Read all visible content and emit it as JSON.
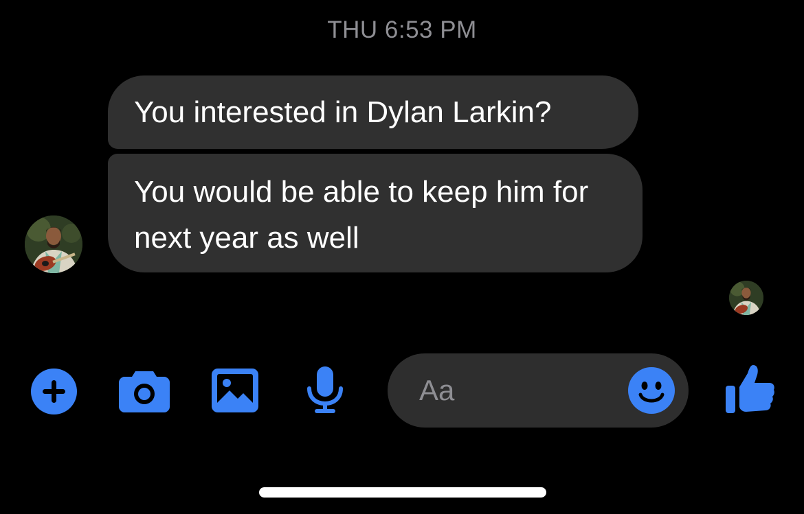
{
  "thread": {
    "timestamp": "THU 6:53 PM"
  },
  "messages": [
    {
      "sender": "other",
      "text": "You interested in Dylan Larkin?"
    },
    {
      "sender": "other",
      "text": "You would be able to keep him for next year as well"
    }
  ],
  "avatars": {
    "sender_avatar": "profile-photo",
    "read_receipt_avatar": "profile-photo"
  },
  "composer": {
    "placeholder": "Aa",
    "value": ""
  },
  "toolbar": {
    "icons": [
      "plus-circle-icon",
      "camera-icon",
      "gallery-icon",
      "microphone-icon",
      "emoji-icon",
      "thumbs-up-icon"
    ]
  },
  "colors": {
    "background": "#000000",
    "bubble": "#303030",
    "accent": "#3b82f6",
    "timestamp": "#8e8e93",
    "composer": "#2e2e2e"
  }
}
